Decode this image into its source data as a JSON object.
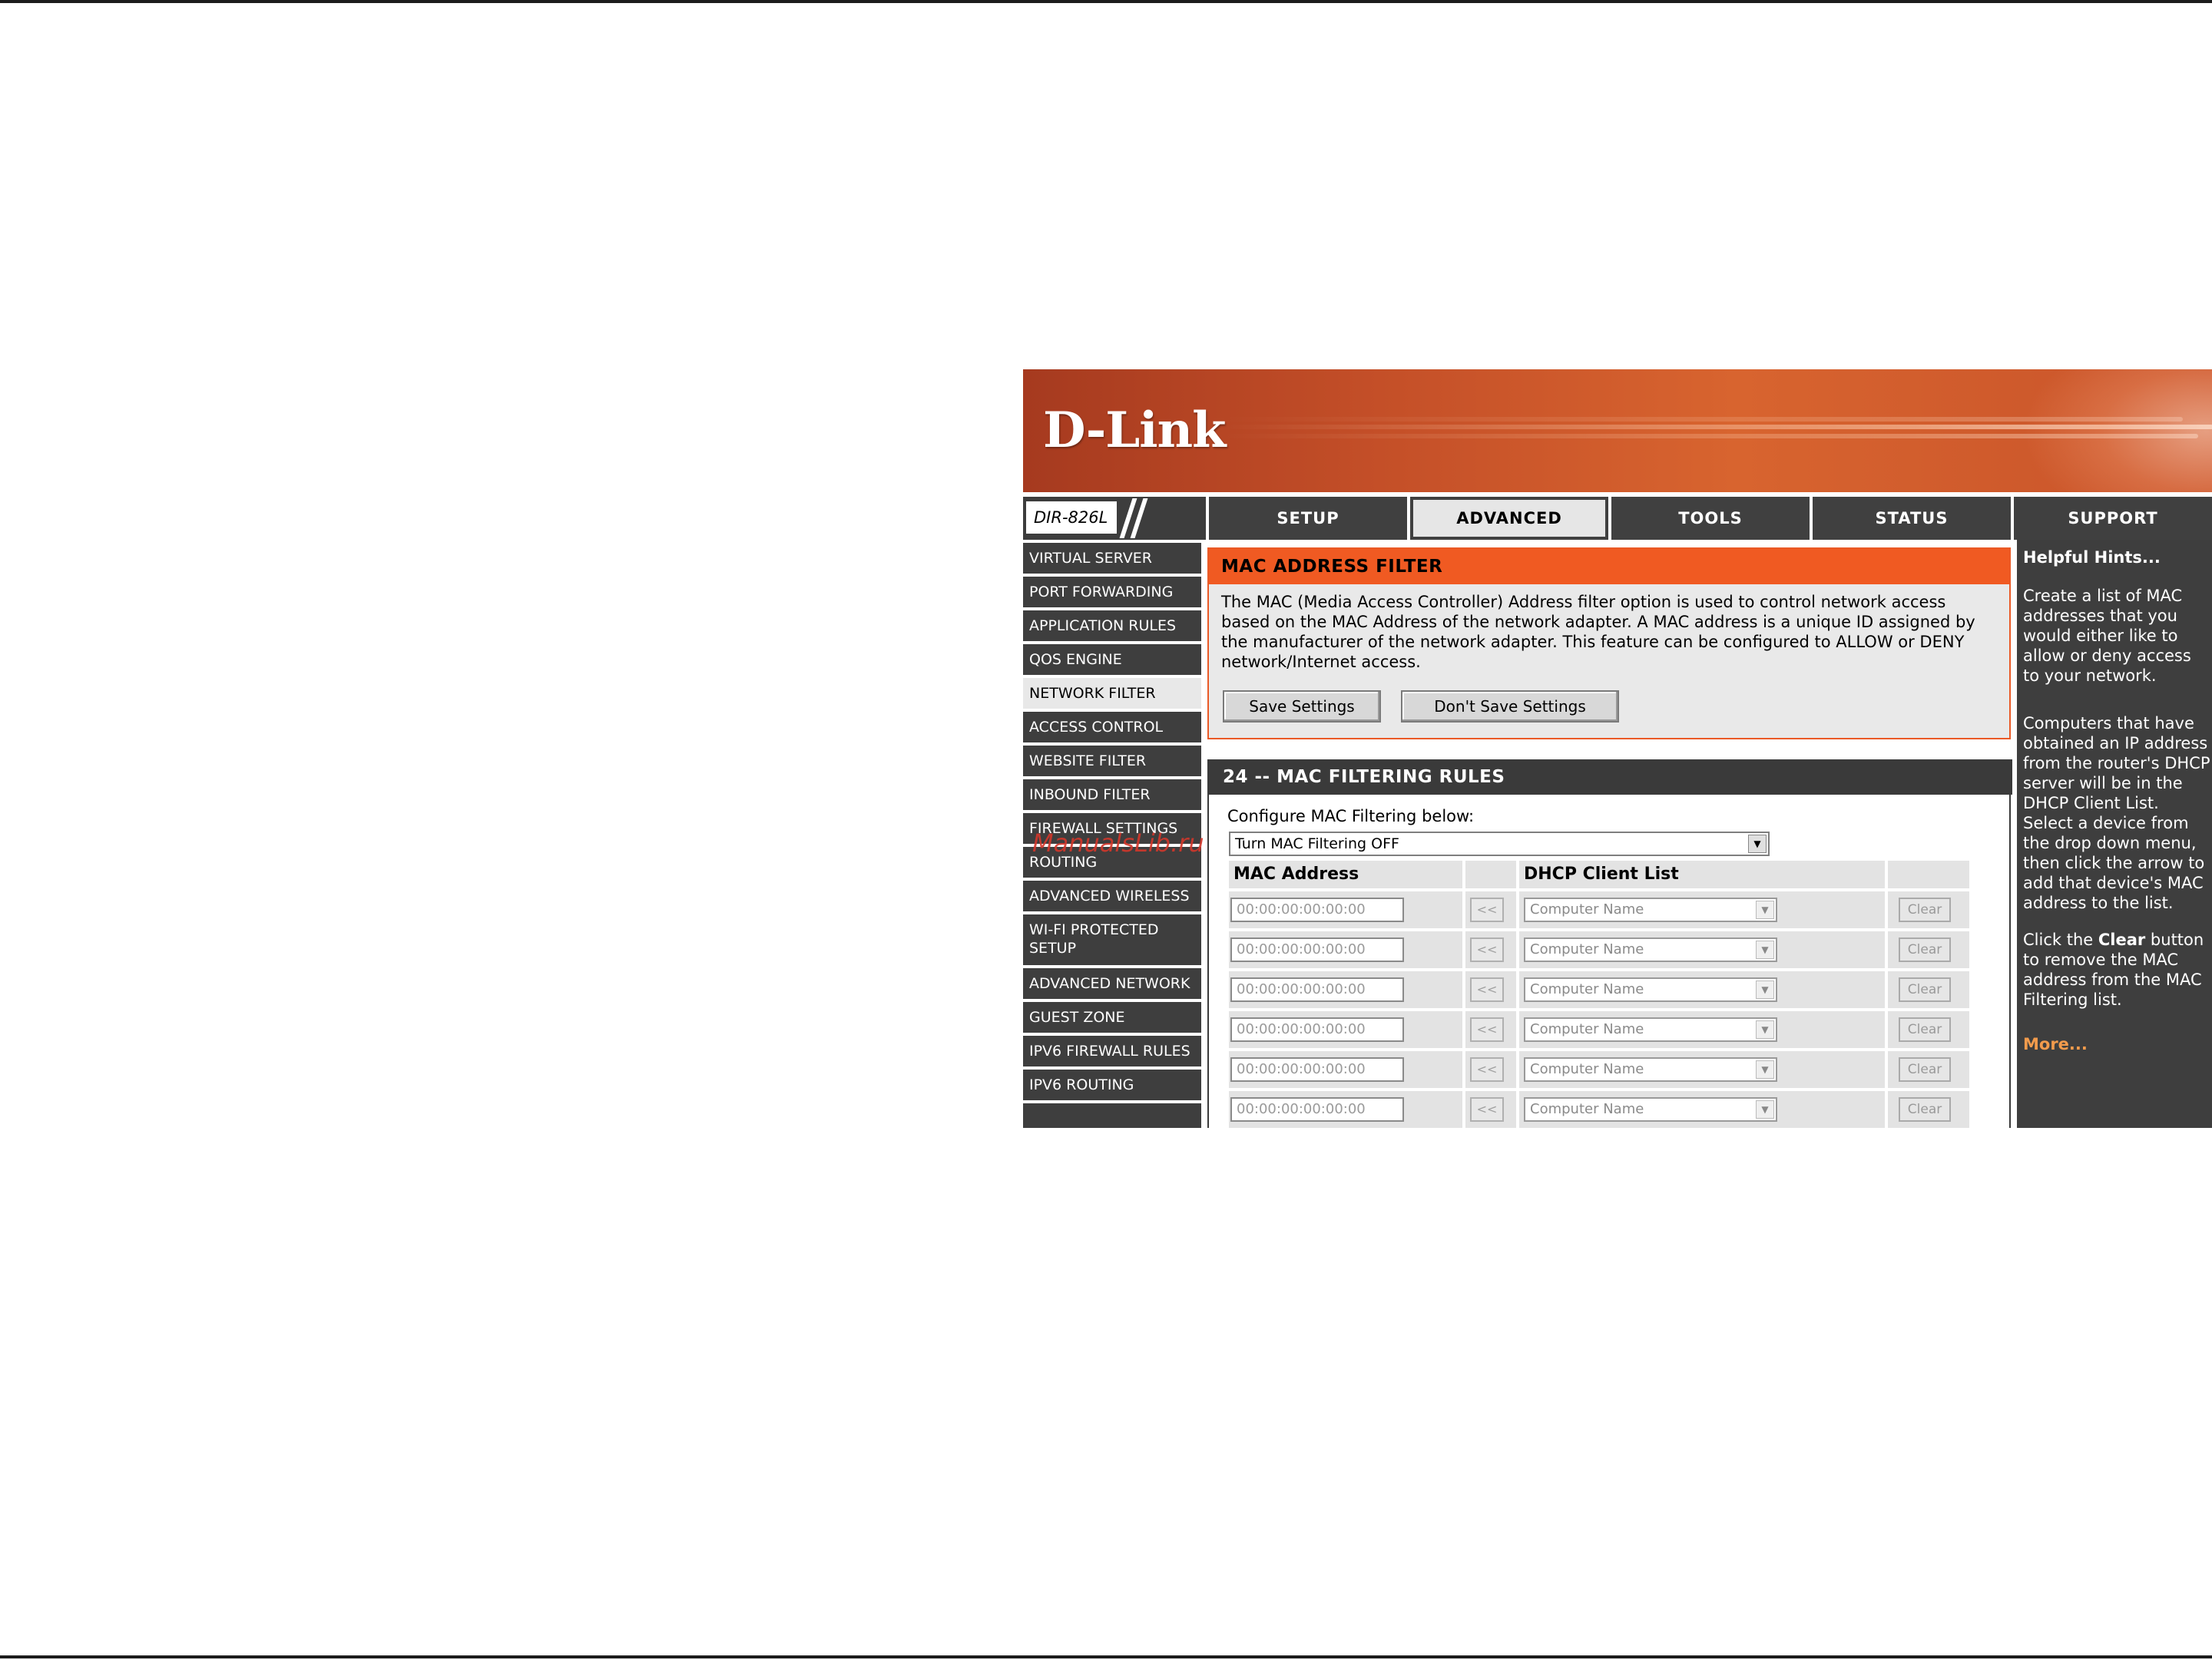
{
  "brand": {
    "logo_text": "D-Link",
    "model": "DIR-826L"
  },
  "nav": {
    "tabs": [
      {
        "label": "SETUP"
      },
      {
        "label": "ADVANCED"
      },
      {
        "label": "TOOLS"
      },
      {
        "label": "STATUS"
      },
      {
        "label": "SUPPORT"
      }
    ],
    "active_tab": "ADVANCED"
  },
  "sidebar": {
    "items": [
      {
        "label": "VIRTUAL SERVER"
      },
      {
        "label": "PORT FORWARDING"
      },
      {
        "label": "APPLICATION RULES"
      },
      {
        "label": "QOS ENGINE"
      },
      {
        "label": "NETWORK FILTER"
      },
      {
        "label": "ACCESS CONTROL"
      },
      {
        "label": "WEBSITE FILTER"
      },
      {
        "label": "INBOUND FILTER"
      },
      {
        "label": "FIREWALL SETTINGS"
      },
      {
        "label": "ROUTING"
      },
      {
        "label": "ADVANCED WIRELESS"
      },
      {
        "label": "WI-FI PROTECTED",
        "label2": "SETUP"
      },
      {
        "label": "ADVANCED NETWORK"
      },
      {
        "label": "GUEST ZONE"
      },
      {
        "label": "IPV6 FIREWALL RULES"
      },
      {
        "label": "IPV6 ROUTING"
      }
    ],
    "active_item": "NETWORK FILTER",
    "watermark": "ManualsLib.ru"
  },
  "filter": {
    "title": "MAC ADDRESS FILTER",
    "description": "The MAC (Media Access Controller) Address filter option is used to control network access based on the MAC Address of the network adapter. A MAC address is a unique ID assigned by the manufacturer of the network adapter. This feature can be configured to ALLOW or DENY network/Internet access.",
    "save_label": "Save Settings",
    "dont_save_label": "Don't Save Settings"
  },
  "rules": {
    "title": "24 -- MAC FILTERING RULES",
    "configure_label": "Configure MAC Filtering below:",
    "mode_value": "Turn MAC Filtering OFF",
    "col_mac": "MAC Address",
    "col_dhcp": "DHCP Client List",
    "arrow_label": "<<",
    "clear_label": "Clear",
    "rows": [
      {
        "mac": "00:00:00:00:00:00",
        "client": "Computer Name"
      },
      {
        "mac": "00:00:00:00:00:00",
        "client": "Computer Name"
      },
      {
        "mac": "00:00:00:00:00:00",
        "client": "Computer Name"
      },
      {
        "mac": "00:00:00:00:00:00",
        "client": "Computer Name"
      },
      {
        "mac": "00:00:00:00:00:00",
        "client": "Computer Name"
      },
      {
        "mac": "00:00:00:00:00:00",
        "client": "Computer Name"
      }
    ]
  },
  "hints": {
    "title": "Helpful Hints...",
    "p1": "Create a list of MAC addresses that you would either like to allow or deny access to your network.",
    "p2": "Computers that have obtained an IP address from the router's DHCP server will be in the DHCP Client List. Select a device from the drop down menu, then click the arrow to add that device's MAC address to the list.",
    "p3_pre": "Click the ",
    "p3_bold": "Clear",
    "p3_post": " button to remove the MAC address from the MAC Filtering list.",
    "more": "More..."
  },
  "colors": {
    "accent": "#f05a22",
    "nav_dark": "#404040",
    "more_link": "#f29b4c"
  },
  "icons": {
    "dropdown": "chevron-down-icon",
    "add_arrow": "double-left-arrow-icon"
  }
}
